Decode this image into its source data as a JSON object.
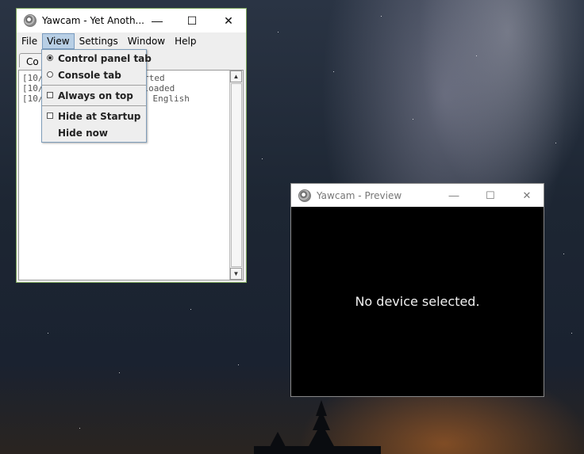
{
  "main_window": {
    "title": "Yawcam - Yet Anoth...",
    "controls": {
      "minimize": "—",
      "maximize": "☐",
      "close": "✕"
    },
    "menubar": {
      "items": [
        "File",
        "View",
        "Settings",
        "Window",
        "Help"
      ],
      "active": "View"
    },
    "tab_label": "Co",
    "console_lines": [
      "[10/",
      "[10/",
      "[10/"
    ],
    "console_suffixes": [
      "arted",
      "loaded",
      "English"
    ]
  },
  "view_menu": {
    "items": [
      {
        "label": "Control panel tab",
        "type": "radio",
        "checked": true
      },
      {
        "label": "Console tab",
        "type": "radio",
        "checked": false
      },
      {
        "label": "Always on top",
        "type": "checkbox",
        "checked": false
      },
      {
        "label": "Hide at Startup",
        "type": "checkbox",
        "checked": false
      },
      {
        "label": "Hide now",
        "type": "action"
      }
    ]
  },
  "preview_window": {
    "title": "Yawcam - Preview",
    "message": "No device selected.",
    "controls": {
      "minimize": "—",
      "maximize": "☐",
      "close": "✕"
    }
  },
  "colors": {
    "menu_highlight": "#b8cfe5",
    "preview_bg": "#000000",
    "window_border": "#7aa35a"
  }
}
